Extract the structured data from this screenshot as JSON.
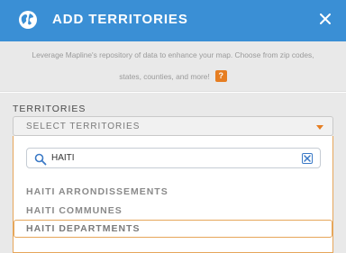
{
  "header": {
    "title": "ADD TERRITORIES",
    "icon": "globe-icon",
    "close_icon": "close-icon",
    "color": "#3a8fd5"
  },
  "intro": {
    "line1": "Leverage Mapline's repository of data to enhance your map. Choose from zip codes,",
    "line2": "states, counties, and more!",
    "help_label": "?"
  },
  "territories": {
    "label": "TERRITORIES",
    "select_placeholder": "SELECT TERRITORIES",
    "search_value": "HAITI",
    "options": [
      "HAITI ARRONDISSEMENTS",
      "HAITI COMMUNES",
      "HAITI DEPARTMENTS"
    ],
    "highlighted_option": "HAITI DEPARTMENTS",
    "accent": "#e67e22"
  }
}
